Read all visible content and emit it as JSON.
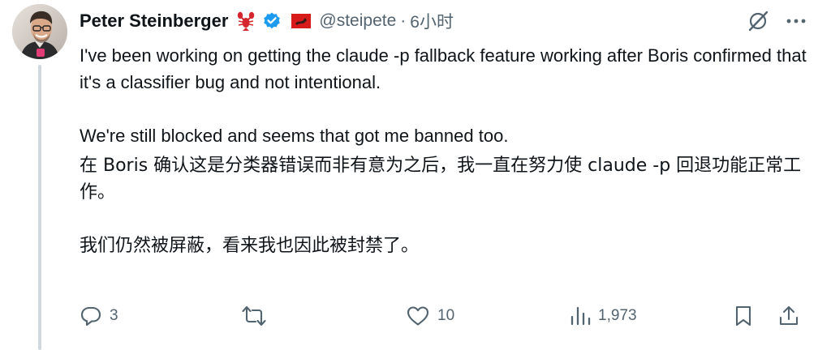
{
  "author": {
    "name": "Peter Steinberger",
    "handle": "@steipete",
    "separator": "·",
    "time": "6小时",
    "badges": [
      "lobster-emoji-icon",
      "verified-badge-icon",
      "red-flag-icon"
    ]
  },
  "header_actions": [
    "grok-slash-icon",
    "more-icon"
  ],
  "post": {
    "original": [
      "I've been working on getting the claude -p fallback feature working after Boris confirmed that it's a classifier bug and not intentional.",
      "We're still blocked and seems that got me banned too."
    ],
    "translation": [
      "在 Boris 确认这是分类器错误而非有意为之后，我一直在努力使 claude -p 回退功能正常工作。",
      "我们仍然被屏蔽，看来我也因此被封禁了。"
    ]
  },
  "actions": {
    "reply_count": "3",
    "repost_count": "",
    "like_count": "10",
    "view_count": "1,973"
  },
  "colors": {
    "text": "#0f1419",
    "muted": "#536471",
    "verified": "#1d9bf0",
    "thread_line": "#cfd9de"
  }
}
